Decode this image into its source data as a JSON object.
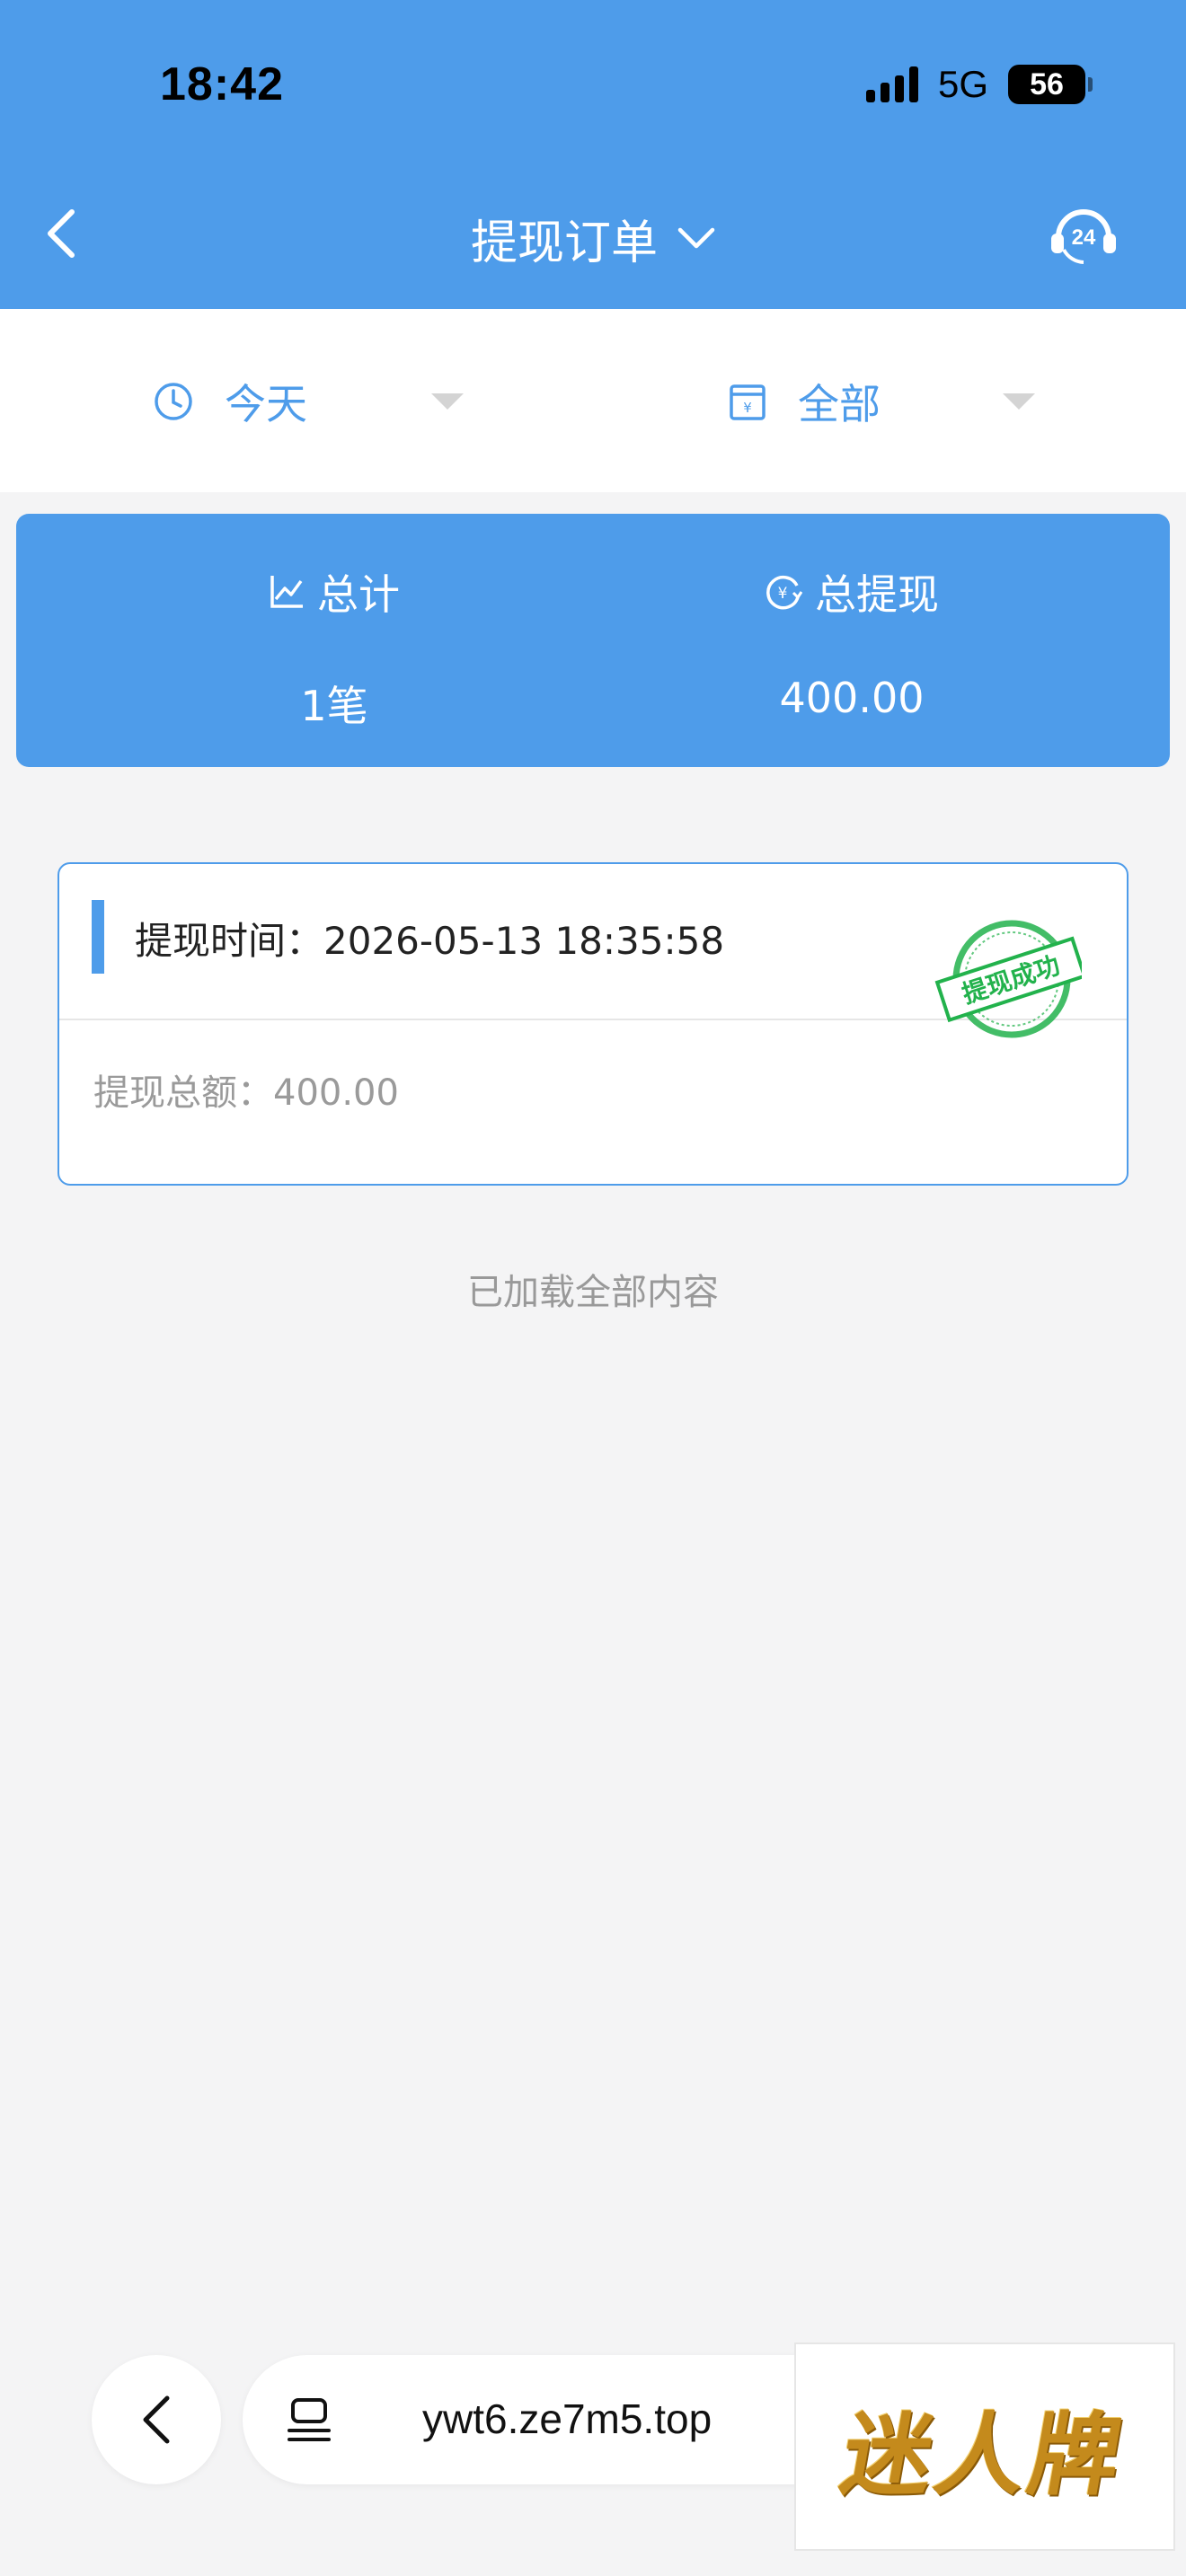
{
  "status_bar": {
    "time": "18:42",
    "network": "5G",
    "battery": "56"
  },
  "nav": {
    "title": "提现订单"
  },
  "filters": [
    {
      "label": "今天",
      "icon": "clock-icon"
    },
    {
      "label": "全部",
      "icon": "calendar-icon"
    }
  ],
  "summary": {
    "total_label": "总计",
    "total_value": "1笔",
    "withdraw_label": "总提现",
    "withdraw_value": "400.00"
  },
  "orders": [
    {
      "time_label": "提现时间：2026-05-13 18:35:58",
      "amount_label": "提现总额：400.00",
      "stamp_text": "提现成功"
    }
  ],
  "list_footer": "已加载全部内容",
  "browser": {
    "url": "ywt6.ze7m5.top"
  },
  "logo_text": "迷人牌",
  "colors": {
    "primary": "#4e9cea",
    "stamp_green": "#22b24c",
    "logo_gold": "#c48a1c"
  }
}
